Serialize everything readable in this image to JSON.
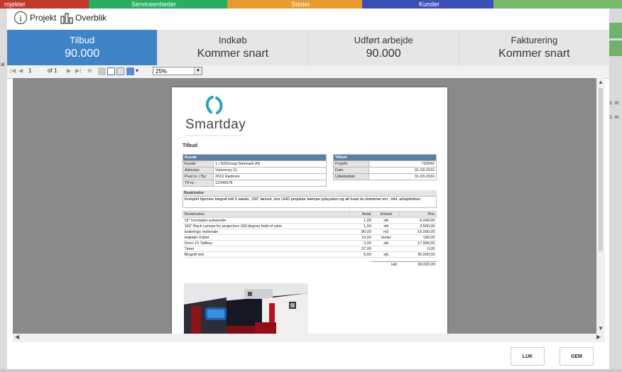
{
  "background": {
    "tabs": [
      {
        "label": "rojekter",
        "color": "#c0392b"
      },
      {
        "label": "Serviceenheder",
        "color": "#27ae60"
      },
      {
        "label": "Steder",
        "color": "#e69b2c"
      },
      {
        "label": "Kunder",
        "color": "#3a4fb8"
      },
      {
        "label": "",
        "color": "#76b96a"
      }
    ],
    "right_texts": [
      "1. m",
      "1. m"
    ],
    "left_text": "al"
  },
  "header": {
    "info_icon_glyph": "i",
    "projekt_label": "Projekt",
    "overblik_label": "Overblik"
  },
  "stages": [
    {
      "title": "Tilbud",
      "value": "90.000",
      "active": true
    },
    {
      "title": "Indkøb",
      "value": "Kommer snart",
      "active": false
    },
    {
      "title": "Udført arbejde",
      "value": "90.000",
      "active": false
    },
    {
      "title": "Fakturering",
      "value": "Kommer snart",
      "active": false
    }
  ],
  "toolbar": {
    "page_current": "1",
    "page_of": "of 1",
    "zoom": "25%"
  },
  "document": {
    "brand": "Smartday",
    "title": "Tilbud",
    "customer": {
      "header": "Kunde",
      "rows": [
        {
          "label": "Kunde",
          "value": "1 / GSGroup Danmark AS"
        },
        {
          "label": "Adresse:",
          "value": "Vojensvej 11"
        },
        {
          "label": "Post nr. / By:",
          "value": "2610 Rødovre"
        },
        {
          "label": "Tlf nr.:",
          "value": "12345678"
        }
      ]
    },
    "offer": {
      "header": "Tilbud",
      "rows": [
        {
          "label": "Projekt",
          "value": "702542"
        },
        {
          "label": "Dato",
          "value": "01-03-2016"
        },
        {
          "label": "Udløbsdato",
          "value": "31-03-2016"
        }
      ]
    },
    "description_header": "Beskrivelse",
    "description": "Komplet hjemme biograf inkl 5 sæder, 150\" lærred, stor UHD projektor kæmpe lydsystem og alt hvad du drømmer om - inkl. arbejdstimer",
    "lines_headers": [
      "Beskrivelse",
      "Antal",
      "Enhed",
      "Pris"
    ],
    "lines": [
      [
        "15\" hornladet subwoofer",
        "1,00",
        "stk",
        "6.000,00"
      ],
      [
        "150\" Back canvas for projectors 100 degree field of view",
        "1,00",
        "stk",
        "3.500,00"
      ],
      [
        "Isolerings materiale",
        "80,00",
        "m2",
        "16.000,00"
      ],
      [
        "Højtaler Kabel",
        "19,00",
        "meter",
        "190,00"
      ],
      [
        "Omni 15 Tallboy",
        "2,00",
        "stk",
        "17.990,00"
      ],
      [
        "Timer",
        "37,00",
        "",
        "0,00"
      ],
      [
        "Biograf stol",
        "5,00",
        "stk",
        "35.000,00"
      ]
    ],
    "total_label": "Ialt.:",
    "total_value": "90.000,00"
  },
  "footer": {
    "close_label": "LUK",
    "save_label": "GEM"
  },
  "colors": {
    "active_stage": "#3f84c7",
    "table_header": "#5b7fa6",
    "logo_teal": "#2aa3b5"
  }
}
